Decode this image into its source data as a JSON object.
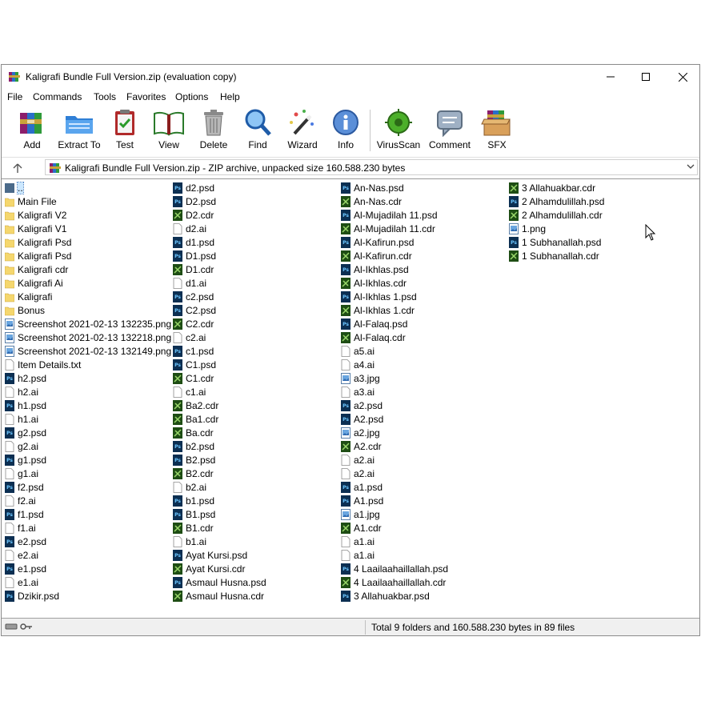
{
  "window": {
    "title": "Kaligrafi Bundle Full Version.zip (evaluation copy)"
  },
  "menu": [
    "File",
    "Commands",
    "Tools",
    "Favorites",
    "Options",
    "Help"
  ],
  "toolbar": [
    {
      "label": "Add",
      "icon": "add-icon"
    },
    {
      "label": "Extract To",
      "icon": "extract-to-icon"
    },
    {
      "label": "Test",
      "icon": "test-icon"
    },
    {
      "label": "View",
      "icon": "view-icon"
    },
    {
      "label": "Delete",
      "icon": "delete-icon"
    },
    {
      "label": "Find",
      "icon": "find-icon"
    },
    {
      "label": "Wizard",
      "icon": "wizard-icon"
    },
    {
      "label": "Info",
      "icon": "info-icon"
    },
    {
      "label": "VirusScan",
      "icon": "virusscan-icon"
    },
    {
      "label": "Comment",
      "icon": "comment-icon"
    },
    {
      "label": "SFX",
      "icon": "sfx-icon"
    }
  ],
  "address": {
    "text": "Kaligrafi Bundle Full Version.zip - ZIP archive, unpacked size 160.588.230 bytes"
  },
  "files": {
    "col1": [
      {
        "name": "..",
        "type": "up"
      },
      {
        "name": "Main File",
        "type": "folder"
      },
      {
        "name": "Kaligrafi V2",
        "type": "folder"
      },
      {
        "name": "Kaligrafi V1",
        "type": "folder"
      },
      {
        "name": "Kaligrafi Psd",
        "type": "folder"
      },
      {
        "name": "Kaligrafi Psd",
        "type": "folder"
      },
      {
        "name": "Kaligrafi cdr",
        "type": "folder"
      },
      {
        "name": "Kaligrafi Ai",
        "type": "folder"
      },
      {
        "name": "Kaligrafi",
        "type": "folder"
      },
      {
        "name": "Bonus",
        "type": "folder"
      },
      {
        "name": "Screenshot 2021-02-13 132235.png",
        "type": "img"
      },
      {
        "name": "Screenshot 2021-02-13 132218.png",
        "type": "img"
      },
      {
        "name": "Screenshot 2021-02-13 132149.png",
        "type": "img"
      },
      {
        "name": "Item Details.txt",
        "type": "txt"
      },
      {
        "name": "h2.psd",
        "type": "psd"
      },
      {
        "name": "h2.ai",
        "type": "ai"
      },
      {
        "name": "h1.psd",
        "type": "psd"
      },
      {
        "name": "h1.ai",
        "type": "ai"
      },
      {
        "name": "g2.psd",
        "type": "psd"
      },
      {
        "name": "g2.ai",
        "type": "ai"
      },
      {
        "name": "g1.psd",
        "type": "psd"
      },
      {
        "name": "g1.ai",
        "type": "ai"
      },
      {
        "name": "f2.psd",
        "type": "psd"
      },
      {
        "name": "f2.ai",
        "type": "ai"
      },
      {
        "name": "f1.psd",
        "type": "psd"
      },
      {
        "name": "f1.ai",
        "type": "ai"
      },
      {
        "name": "e2.psd",
        "type": "psd"
      },
      {
        "name": "e2.ai",
        "type": "ai"
      },
      {
        "name": "e1.psd",
        "type": "psd"
      },
      {
        "name": "e1.ai",
        "type": "ai"
      },
      {
        "name": "Dzikir.psd",
        "type": "psd"
      }
    ],
    "col2": [
      {
        "name": "d2.psd",
        "type": "psd"
      },
      {
        "name": "D2.psd",
        "type": "psd"
      },
      {
        "name": "D2.cdr",
        "type": "cdr"
      },
      {
        "name": "d2.ai",
        "type": "ai"
      },
      {
        "name": "d1.psd",
        "type": "psd"
      },
      {
        "name": "D1.psd",
        "type": "psd"
      },
      {
        "name": "D1.cdr",
        "type": "cdr"
      },
      {
        "name": "d1.ai",
        "type": "ai"
      },
      {
        "name": "c2.psd",
        "type": "psd"
      },
      {
        "name": "C2.psd",
        "type": "psd"
      },
      {
        "name": "C2.cdr",
        "type": "cdr"
      },
      {
        "name": "c2.ai",
        "type": "ai"
      },
      {
        "name": "c1.psd",
        "type": "psd"
      },
      {
        "name": "C1.psd",
        "type": "psd"
      },
      {
        "name": "C1.cdr",
        "type": "cdr"
      },
      {
        "name": "c1.ai",
        "type": "ai"
      },
      {
        "name": "Ba2.cdr",
        "type": "cdr"
      },
      {
        "name": "Ba1.cdr",
        "type": "cdr"
      },
      {
        "name": "Ba.cdr",
        "type": "cdr"
      },
      {
        "name": "b2.psd",
        "type": "psd"
      },
      {
        "name": "B2.psd",
        "type": "psd"
      },
      {
        "name": "B2.cdr",
        "type": "cdr"
      },
      {
        "name": "b2.ai",
        "type": "ai"
      },
      {
        "name": "b1.psd",
        "type": "psd"
      },
      {
        "name": "B1.psd",
        "type": "psd"
      },
      {
        "name": "B1.cdr",
        "type": "cdr"
      },
      {
        "name": "b1.ai",
        "type": "ai"
      },
      {
        "name": "Ayat Kursi.psd",
        "type": "psd"
      },
      {
        "name": "Ayat Kursi.cdr",
        "type": "cdr"
      },
      {
        "name": "Asmaul Husna.psd",
        "type": "psd"
      },
      {
        "name": "Asmaul Husna.cdr",
        "type": "cdr"
      }
    ],
    "col3": [
      {
        "name": "An-Nas.psd",
        "type": "psd"
      },
      {
        "name": "An-Nas.cdr",
        "type": "cdr"
      },
      {
        "name": "Al-Mujadilah 11.psd",
        "type": "psd"
      },
      {
        "name": "Al-Mujadilah 11.cdr",
        "type": "cdr"
      },
      {
        "name": "Al-Kafirun.psd",
        "type": "psd"
      },
      {
        "name": "Al-Kafirun.cdr",
        "type": "cdr"
      },
      {
        "name": "Al-Ikhlas.psd",
        "type": "psd"
      },
      {
        "name": "Al-Ikhlas.cdr",
        "type": "cdr"
      },
      {
        "name": "Al-Ikhlas 1.psd",
        "type": "psd"
      },
      {
        "name": "Al-Ikhlas 1.cdr",
        "type": "cdr"
      },
      {
        "name": "Al-Falaq.psd",
        "type": "psd"
      },
      {
        "name": "Al-Falaq.cdr",
        "type": "cdr"
      },
      {
        "name": "a5.ai",
        "type": "ai"
      },
      {
        "name": "a4.ai",
        "type": "ai"
      },
      {
        "name": "a3.jpg",
        "type": "img"
      },
      {
        "name": "a3.ai",
        "type": "ai"
      },
      {
        "name": "a2.psd",
        "type": "psd"
      },
      {
        "name": "A2.psd",
        "type": "psd"
      },
      {
        "name": "a2.jpg",
        "type": "img"
      },
      {
        "name": "A2.cdr",
        "type": "cdr"
      },
      {
        "name": "a2.ai",
        "type": "ai"
      },
      {
        "name": "a2.ai",
        "type": "ai"
      },
      {
        "name": "a1.psd",
        "type": "psd"
      },
      {
        "name": "A1.psd",
        "type": "psd"
      },
      {
        "name": "a1.jpg",
        "type": "img"
      },
      {
        "name": "A1.cdr",
        "type": "cdr"
      },
      {
        "name": "a1.ai",
        "type": "ai"
      },
      {
        "name": "a1.ai",
        "type": "ai"
      },
      {
        "name": "4 Laailaahaillallah.psd",
        "type": "psd"
      },
      {
        "name": "4 Laailaahaillallah.cdr",
        "type": "cdr"
      },
      {
        "name": "3 Allahuakbar.psd",
        "type": "psd"
      }
    ],
    "col4": [
      {
        "name": "3 Allahuakbar.cdr",
        "type": "cdr"
      },
      {
        "name": "2 Alhamdulillah.psd",
        "type": "psd"
      },
      {
        "name": "2 Alhamdulillah.cdr",
        "type": "cdr"
      },
      {
        "name": "1.png",
        "type": "img"
      },
      {
        "name": "1 Subhanallah.psd",
        "type": "psd"
      },
      {
        "name": "1 Subhanallah.cdr",
        "type": "cdr"
      }
    ]
  },
  "status": {
    "text": "Total 9 folders and 160.588.230 bytes in 89 files"
  },
  "colors": {
    "folder": "#f5d76e",
    "psd": "#0c2f52",
    "cdr": "#1e4d14",
    "selection": "#cce8ff"
  }
}
